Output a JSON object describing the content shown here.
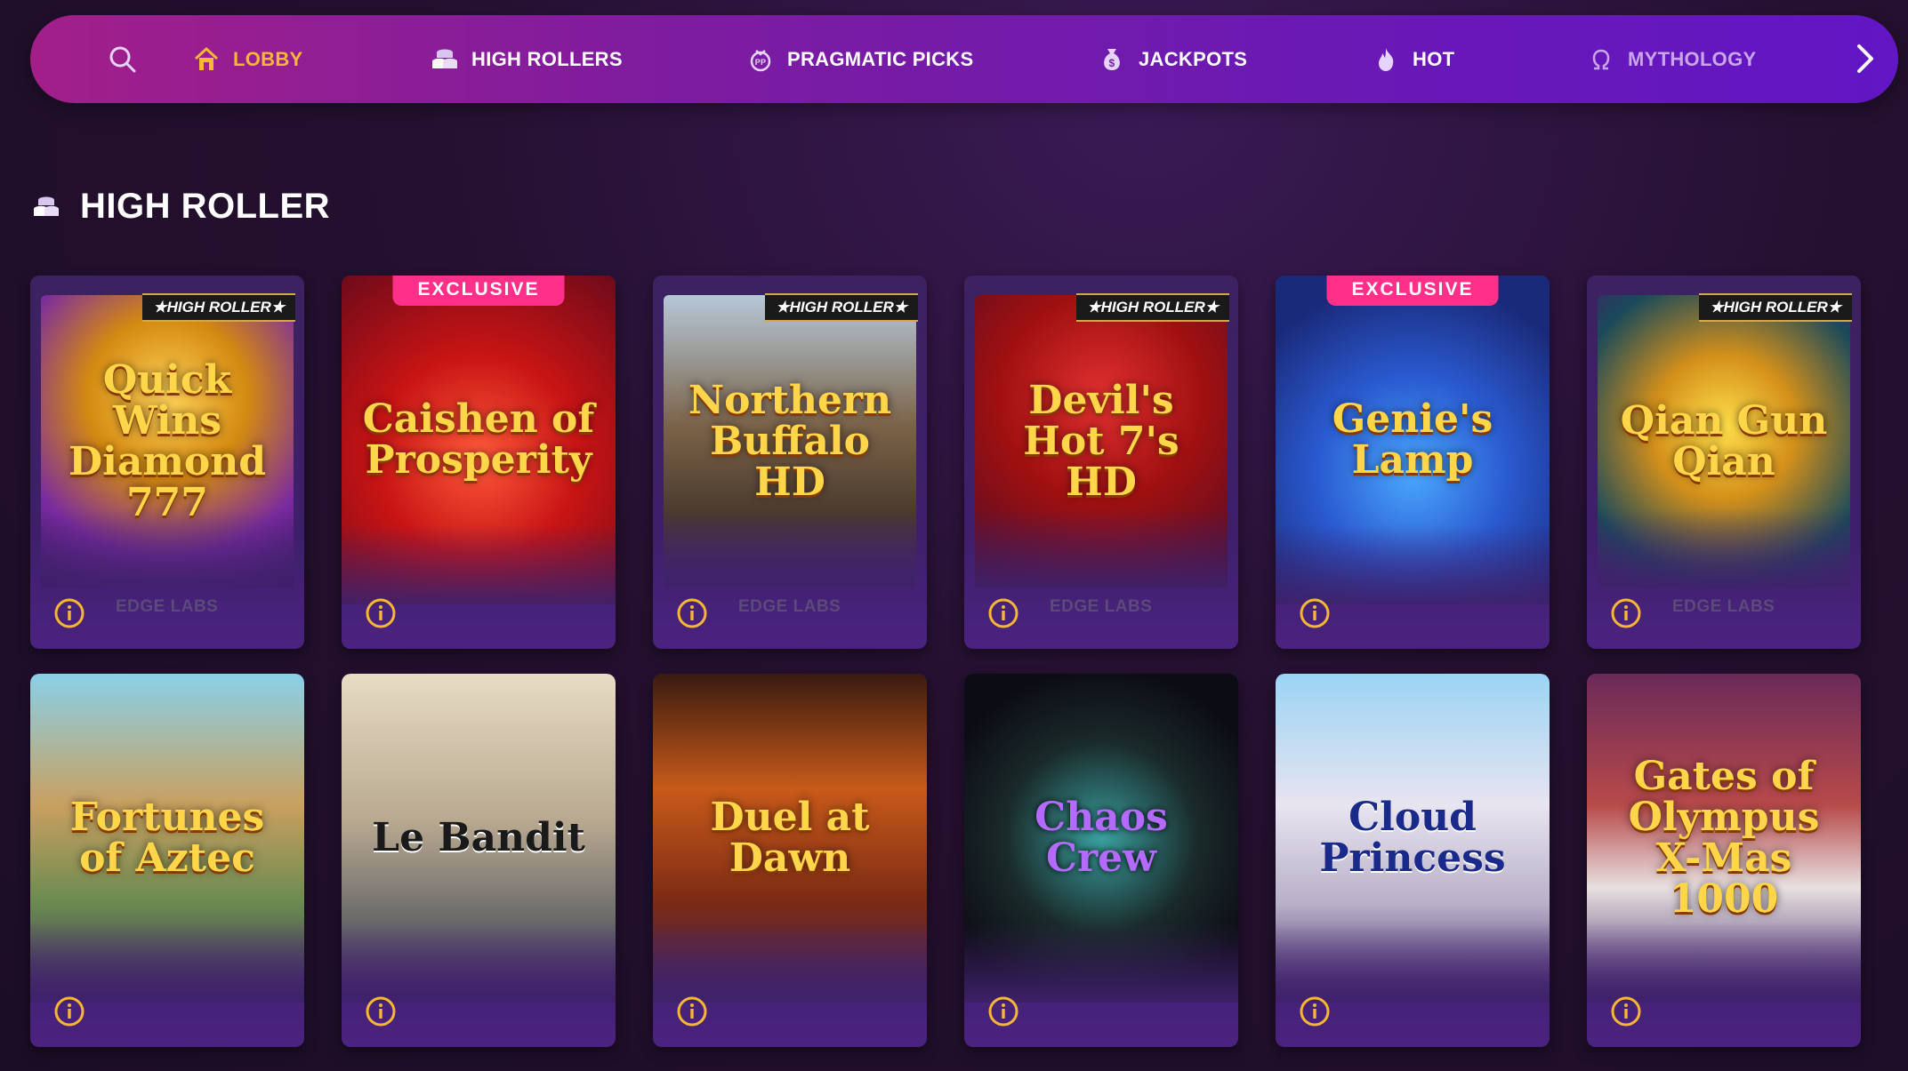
{
  "nav": {
    "items": [
      {
        "label": "LOBBY",
        "icon": "home-icon",
        "active": true
      },
      {
        "label": "HIGH ROLLERS",
        "icon": "chip-stack-icon"
      },
      {
        "label": "PRAGMATIC PICKS",
        "icon": "pragmatic-icon"
      },
      {
        "label": "JACKPOTS",
        "icon": "money-bag-icon"
      },
      {
        "label": "HOT",
        "icon": "flame-icon"
      },
      {
        "label": "MYTHOLOGY",
        "icon": "omega-icon"
      }
    ]
  },
  "section": {
    "title": "HIGH ROLLER",
    "icon": "chip-stack-icon"
  },
  "games": [
    {
      "name": "Quick Wins Diamond 777",
      "badge": "★HIGH ROLLER★",
      "provider": "EDGE LABS"
    },
    {
      "name": "Caishen of Prosperity",
      "badge": "EXCLUSIVE",
      "provider": ""
    },
    {
      "name": "Northern Buffalo HD",
      "badge": "★HIGH ROLLER★",
      "provider": "EDGE LABS"
    },
    {
      "name": "Devil's Hot 7's HD",
      "badge": "★HIGH ROLLER★",
      "provider": "EDGE LABS"
    },
    {
      "name": "Genie's Lamp",
      "badge": "EXCLUSIVE",
      "provider": ""
    },
    {
      "name": "Qian Gun Qian",
      "badge": "★HIGH ROLLER★",
      "provider": "EDGE LABS"
    },
    {
      "name": "Fortunes of Aztec",
      "badge": "",
      "provider": ""
    },
    {
      "name": "Le Bandit",
      "badge": "",
      "provider": ""
    },
    {
      "name": "Duel at Dawn",
      "badge": "",
      "provider": ""
    },
    {
      "name": "Chaos Crew",
      "badge": "",
      "provider": ""
    },
    {
      "name": "Cloud Princess",
      "badge": "",
      "provider": ""
    },
    {
      "name": "Gates of Olympus X-Mas 1000",
      "badge": "",
      "provider": ""
    }
  ],
  "colors": {
    "accent": "#f7b733",
    "exclusive": "#ff2f8a"
  }
}
